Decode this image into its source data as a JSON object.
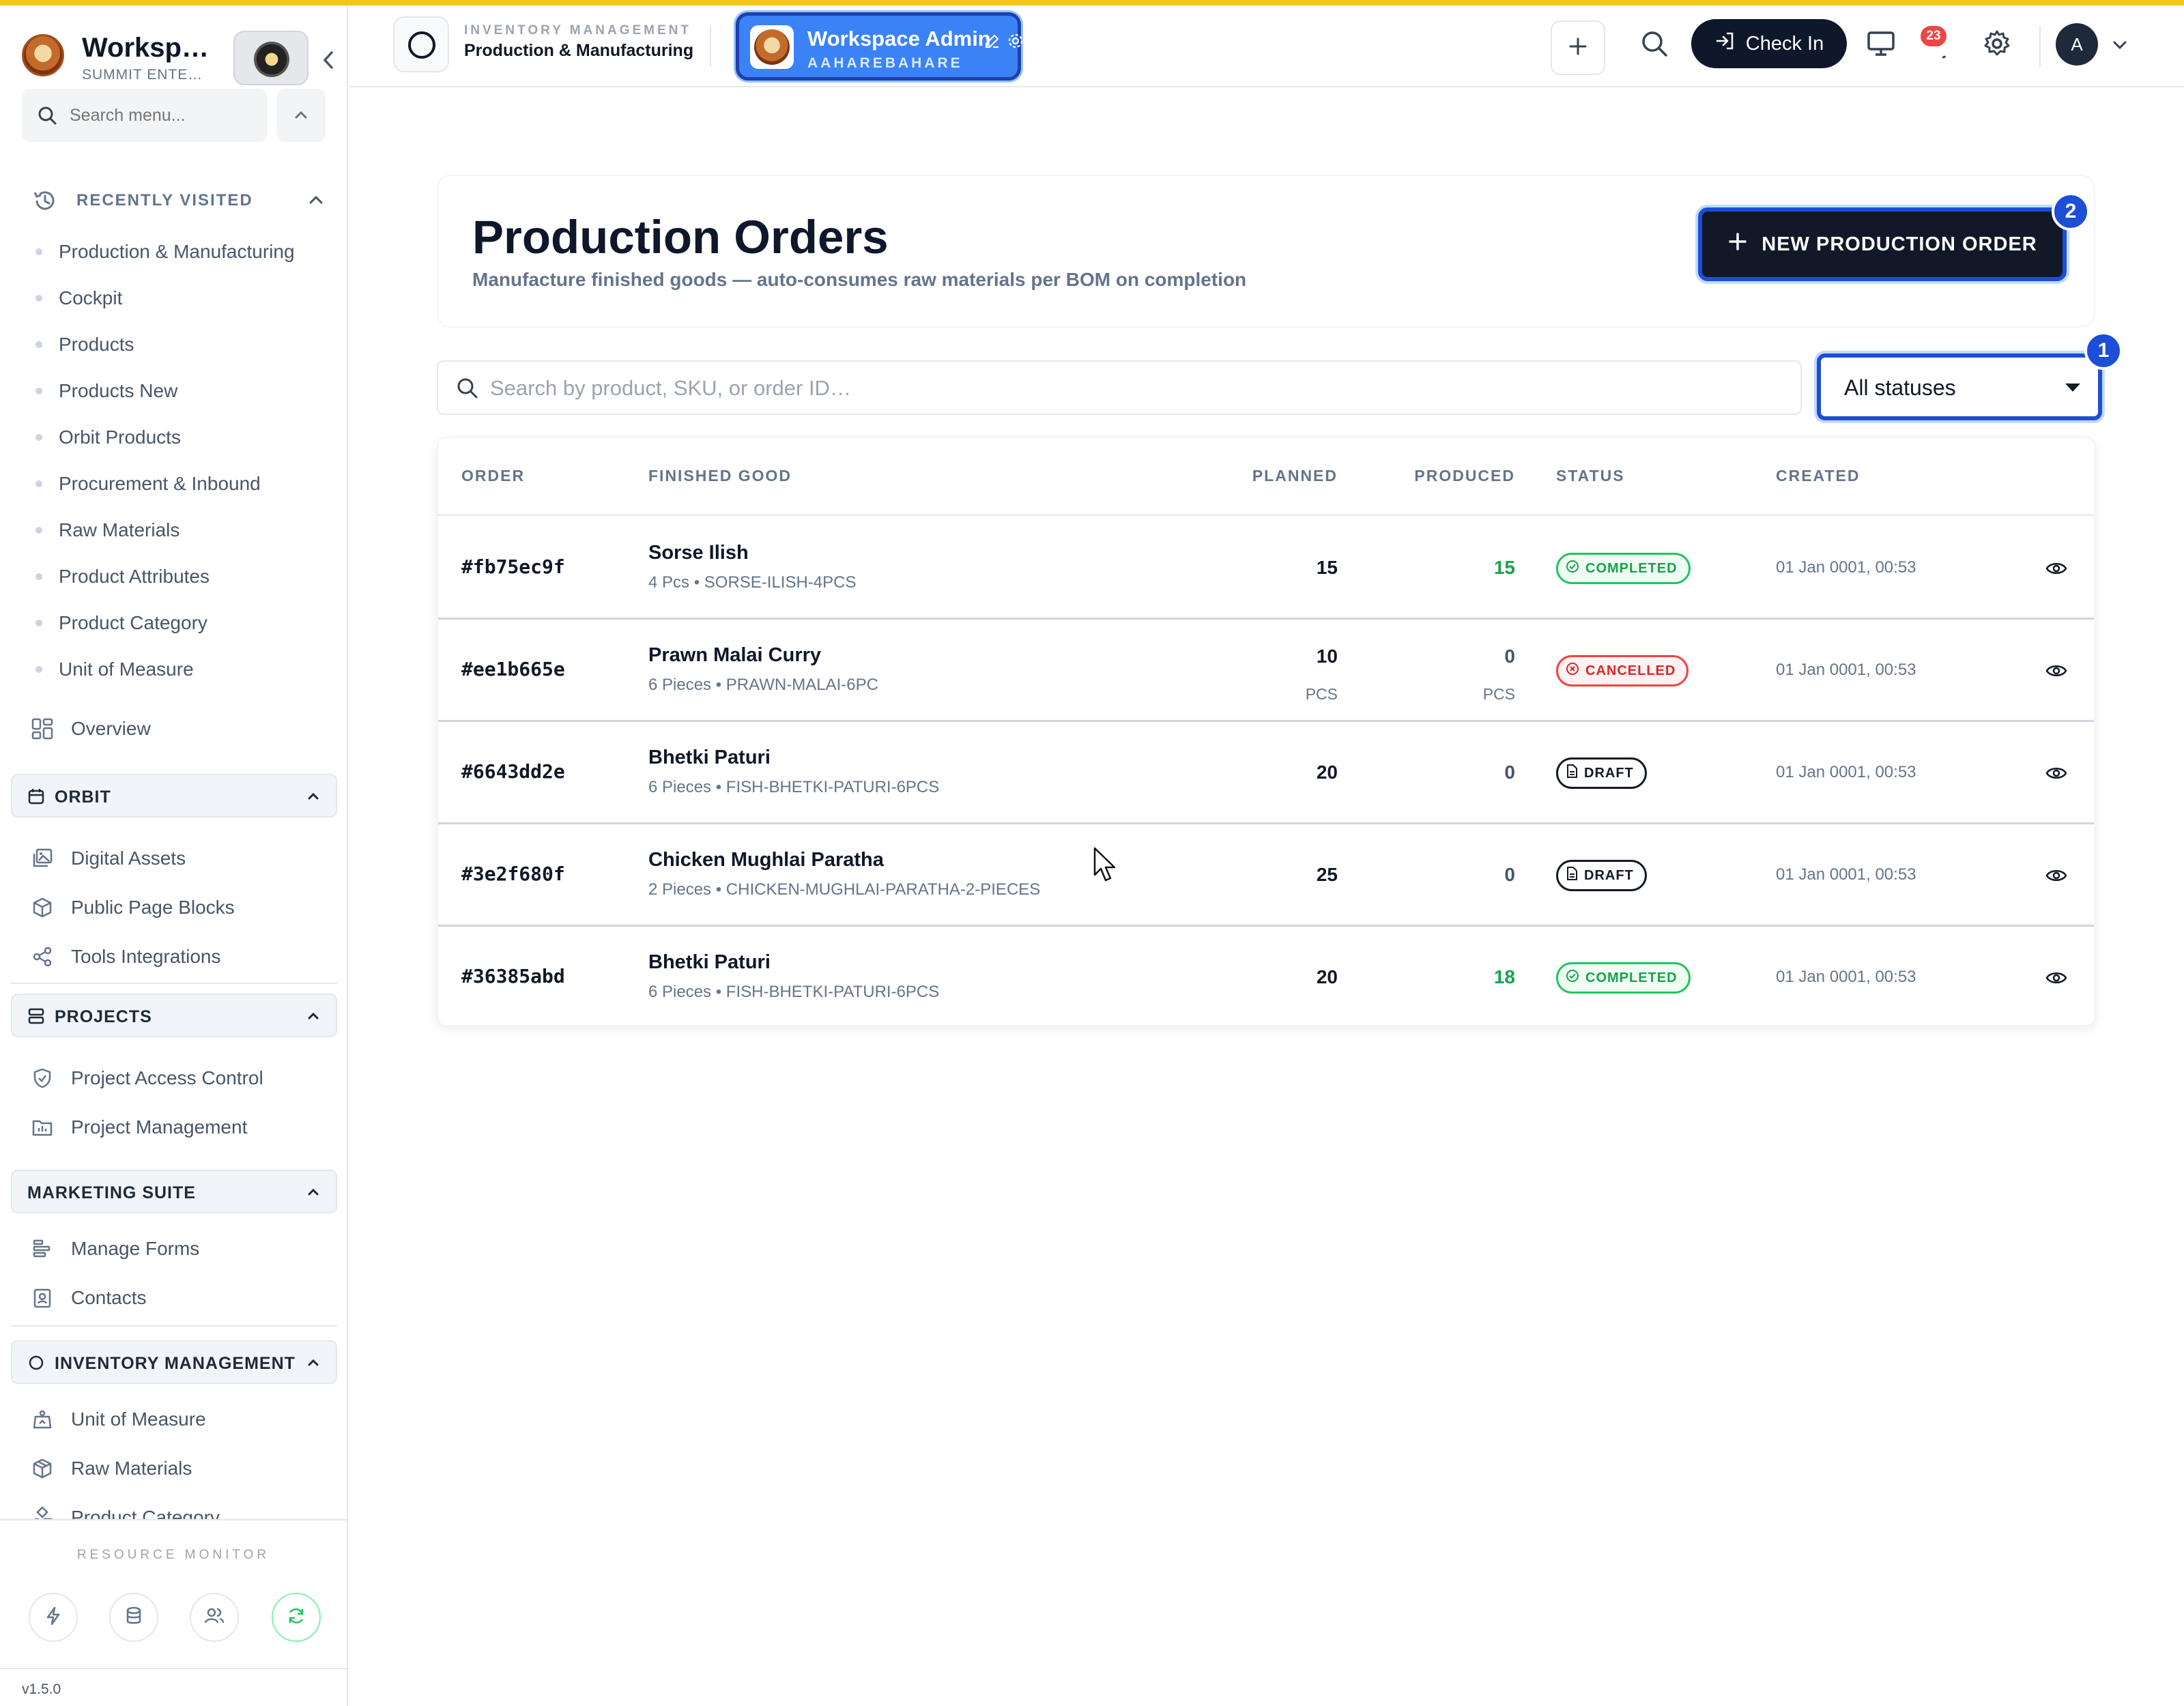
{
  "sidebar": {
    "brand_title": "Worksp…",
    "brand_subtitle": "SUMMIT ENTE…",
    "search_placeholder": "Search menu...",
    "recently_visited_label": "RECENTLY VISITED",
    "recently_visited": [
      "Production & Manufacturing",
      "Cockpit",
      "Products",
      "Products New",
      "Orbit Products",
      "Procurement & Inbound",
      "Raw Materials",
      "Product Attributes",
      "Product Category",
      "Unit of Measure"
    ],
    "overview": "Overview",
    "orbit": {
      "label": "ORBIT",
      "items": [
        "Digital Assets",
        "Public Page Blocks",
        "Tools Integrations"
      ]
    },
    "projects": {
      "label": "PROJECTS",
      "items": [
        "Project Access Control",
        "Project Management"
      ]
    },
    "marketing": {
      "label": "MARKETING SUITE",
      "items": [
        "Manage Forms",
        "Contacts"
      ]
    },
    "inventory": {
      "label": "INVENTORY MANAGEMENT",
      "items": [
        "Unit of Measure",
        "Raw Materials",
        "Product Category"
      ]
    },
    "resource_monitor": "RESOURCE MONITOR",
    "version": "v1.5.0"
  },
  "header": {
    "section_sup": "INVENTORY MANAGEMENT",
    "section_main": "Production & Manufacturing",
    "workspace_name": "Workspace Admin",
    "workspace_sub": "AAHAREBAHARE",
    "check_in": "Check In",
    "notification_count": "23",
    "user_initial": "A"
  },
  "page": {
    "title": "Production Orders",
    "subtitle": "Manufacture finished goods — auto-consumes raw materials per BOM on completion",
    "new_order_label": "NEW PRODUCTION ORDER",
    "new_order_badge": "2",
    "search_placeholder": "Search by product, SKU, or order ID…",
    "status_filter": "All statuses",
    "status_badge": "1"
  },
  "table": {
    "headers": {
      "order": "ORDER",
      "finished_good": "FINISHED GOOD",
      "planned": "PLANNED",
      "produced": "PRODUCED",
      "status": "STATUS",
      "created": "CREATED"
    },
    "rows": [
      {
        "id": "#fb75ec9f",
        "product": "Sorse Ilish",
        "meta": "4 Pcs • SORSE-ILISH-4PCS",
        "planned": "15",
        "produced": "15",
        "planned_unit": "",
        "produced_unit": "",
        "status": "COMPLETED",
        "created": "01 Jan 0001, 00:53"
      },
      {
        "id": "#ee1b665e",
        "product": "Prawn Malai Curry",
        "meta": "6 Pieces • PRAWN-MALAI-6PC",
        "planned": "10",
        "produced": "0",
        "planned_unit": "PCS",
        "produced_unit": "PCS",
        "status": "CANCELLED",
        "created": "01 Jan 0001, 00:53"
      },
      {
        "id": "#6643dd2e",
        "product": "Bhetki Paturi",
        "meta": "6 Pieces • FISH-BHETKI-PATURI-6PCS",
        "planned": "20",
        "produced": "0",
        "planned_unit": "",
        "produced_unit": "",
        "status": "DRAFT",
        "created": "01 Jan 0001, 00:53"
      },
      {
        "id": "#3e2f680f",
        "product": "Chicken Mughlai Paratha",
        "meta": "2 Pieces • CHICKEN-MUGHLAI-PARATHA-2-PIECES",
        "planned": "25",
        "produced": "0",
        "planned_unit": "",
        "produced_unit": "",
        "status": "DRAFT",
        "created": "01 Jan 0001, 00:53"
      },
      {
        "id": "#36385abd",
        "product": "Bhetki Paturi",
        "meta": "6 Pieces • FISH-BHETKI-PATURI-6PCS",
        "planned": "20",
        "produced": "18",
        "planned_unit": "",
        "produced_unit": "",
        "status": "COMPLETED",
        "created": "01 Jan 0001, 00:53"
      }
    ]
  },
  "colors": {
    "accent": "#1d4ed8",
    "workspace_button": "#3b82f6",
    "primary_dark": "#111827",
    "completed": "#16a34a",
    "cancelled": "#dc2626",
    "top_strip": "#f5c518"
  }
}
